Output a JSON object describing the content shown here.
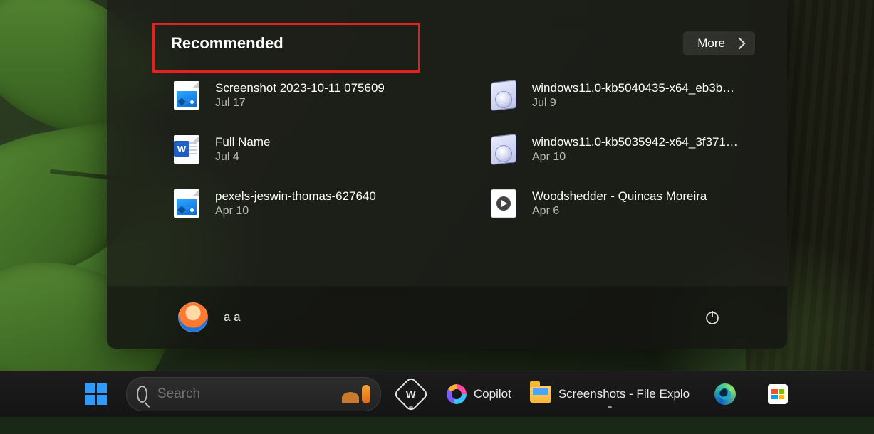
{
  "recommended": {
    "title": "Recommended",
    "more_label": "More",
    "items": [
      {
        "name": "Screenshot 2023-10-11 075609",
        "date": "Jul 17",
        "icon": "image"
      },
      {
        "name": "windows11.0-kb5040435-x64_eb3b…",
        "date": "Jul 9",
        "icon": "msu"
      },
      {
        "name": "Full Name",
        "date": "Jul 4",
        "icon": "word"
      },
      {
        "name": "windows11.0-kb5035942-x64_3f371…",
        "date": "Apr 10",
        "icon": "msu"
      },
      {
        "name": "pexels-jeswin-thomas-627640",
        "date": "Apr 10",
        "icon": "image"
      },
      {
        "name": "Woodshedder - Quincas Moreira",
        "date": "Apr 6",
        "icon": "media"
      }
    ]
  },
  "user": {
    "name": "a a"
  },
  "taskbar": {
    "search_placeholder": "Search",
    "copilot_label": "Copilot",
    "explorer_label": "Screenshots - File Explo"
  }
}
